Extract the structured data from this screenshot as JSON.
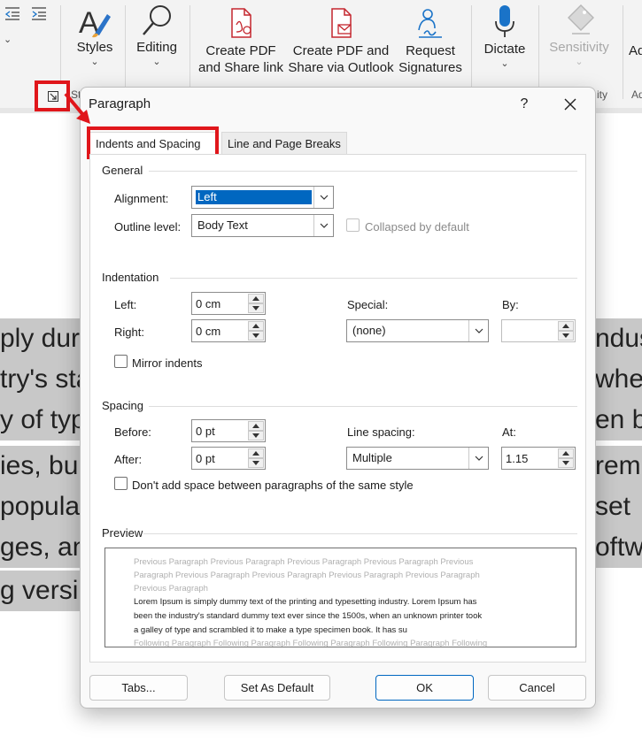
{
  "ribbon": {
    "styles_label": "Styles",
    "editing_label": "Editing",
    "create_pdf_share_link": [
      "Create PDF",
      "and Share link"
    ],
    "create_pdf_outlook": [
      "Create PDF and",
      "Share via Outlook"
    ],
    "request_signatures": [
      "Request",
      "Signatures"
    ],
    "dictate_label": "Dictate",
    "sensitivity_label": "Sensitivity",
    "addin_partial": "Ad",
    "group_label_partial": "St",
    "group_label_right": "ity",
    "group_label_far": "Ad",
    "chevron": "⌄"
  },
  "document": {
    "left_fragments": [
      "ply dur",
      "try's sta",
      "y of typ",
      "ies, bu",
      "popular",
      "ges, an",
      "g versi"
    ],
    "right_fragments": [
      "ndus",
      "whe",
      "en b",
      "rem",
      "set",
      "oftw",
      ""
    ]
  },
  "dialog": {
    "title": "Paragraph",
    "help": "?",
    "tabs": [
      "Indents and Spacing",
      "Line and Page Breaks"
    ],
    "general": {
      "heading": "General",
      "alignment_label": "Alignment:",
      "alignment_value": "Left",
      "outline_label": "Outline level:",
      "outline_value": "Body Text",
      "collapsed_label": "Collapsed by default"
    },
    "indentation": {
      "heading": "Indentation",
      "left_label": "Left:",
      "left_value": "0 cm",
      "right_label": "Right:",
      "right_value": "0 cm",
      "special_label": "Special:",
      "special_value": "(none)",
      "by_label": "By:",
      "by_value": "",
      "mirror_label": "Mirror indents"
    },
    "spacing": {
      "heading": "Spacing",
      "before_label": "Before:",
      "before_value": "0 pt",
      "after_label": "After:",
      "after_value": "0 pt",
      "line_spacing_label": "Line spacing:",
      "line_spacing_value": "Multiple",
      "at_label": "At:",
      "at_value": "1.15",
      "dont_add_label": "Don't add space between paragraphs of the same style"
    },
    "preview": {
      "heading": "Preview",
      "prev_lines": [
        "Previous Paragraph Previous Paragraph Previous Paragraph Previous Paragraph Previous",
        "Paragraph Previous Paragraph Previous Paragraph Previous Paragraph Previous Paragraph",
        "Previous Paragraph"
      ],
      "sample_lines": [
        "Lorem Ipsum is simply dummy text of the printing and typesetting industry. Lorem Ipsum has",
        "been the industry's standard dummy text ever since the 1500s, when an unknown printer took",
        "a galley of type and scrambled it to make a type specimen book. It has su"
      ],
      "following_line": "Following Paragraph Following Paragraph Following Paragraph Following Paragraph Following"
    },
    "buttons": {
      "tabs": "Tabs...",
      "set_default": "Set As Default",
      "ok": "OK",
      "cancel": "Cancel"
    }
  },
  "colors": {
    "highlight_red": "#e0161b",
    "accent_blue": "#0067c0",
    "pdf_red": "#c4262e",
    "dictate_blue": "#1a73c8"
  }
}
